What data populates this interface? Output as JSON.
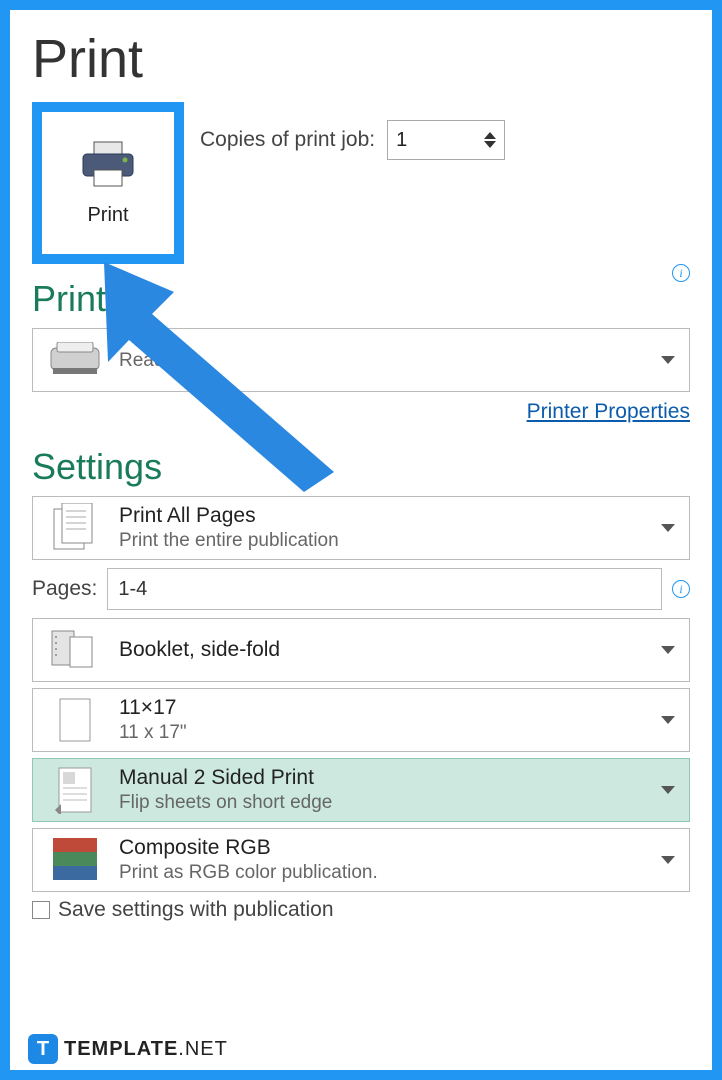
{
  "title": "Print",
  "print_button_label": "Print",
  "copies_label": "Copies of print job:",
  "copies_value": "1",
  "printer": {
    "section_label": "Printer",
    "name": "",
    "status": "Ready",
    "properties_link": "Printer Properties"
  },
  "settings": {
    "section_label": "Settings",
    "print_range": {
      "title": "Print All Pages",
      "subtitle": "Print the entire publication"
    },
    "pages_label": "Pages:",
    "pages_value": "1-4",
    "layout": {
      "title": "Booklet, side-fold",
      "subtitle": ""
    },
    "paper": {
      "title": "11×17",
      "subtitle": "11 x 17\""
    },
    "duplex": {
      "title": "Manual 2 Sided Print",
      "subtitle": "Flip sheets on short edge"
    },
    "color": {
      "title": "Composite RGB",
      "subtitle": "Print as RGB color publication."
    },
    "save_label": "Save settings with publication"
  },
  "watermark": {
    "badge": "T",
    "text_bold": "TEMPLATE",
    "text_thin": ".NET"
  }
}
